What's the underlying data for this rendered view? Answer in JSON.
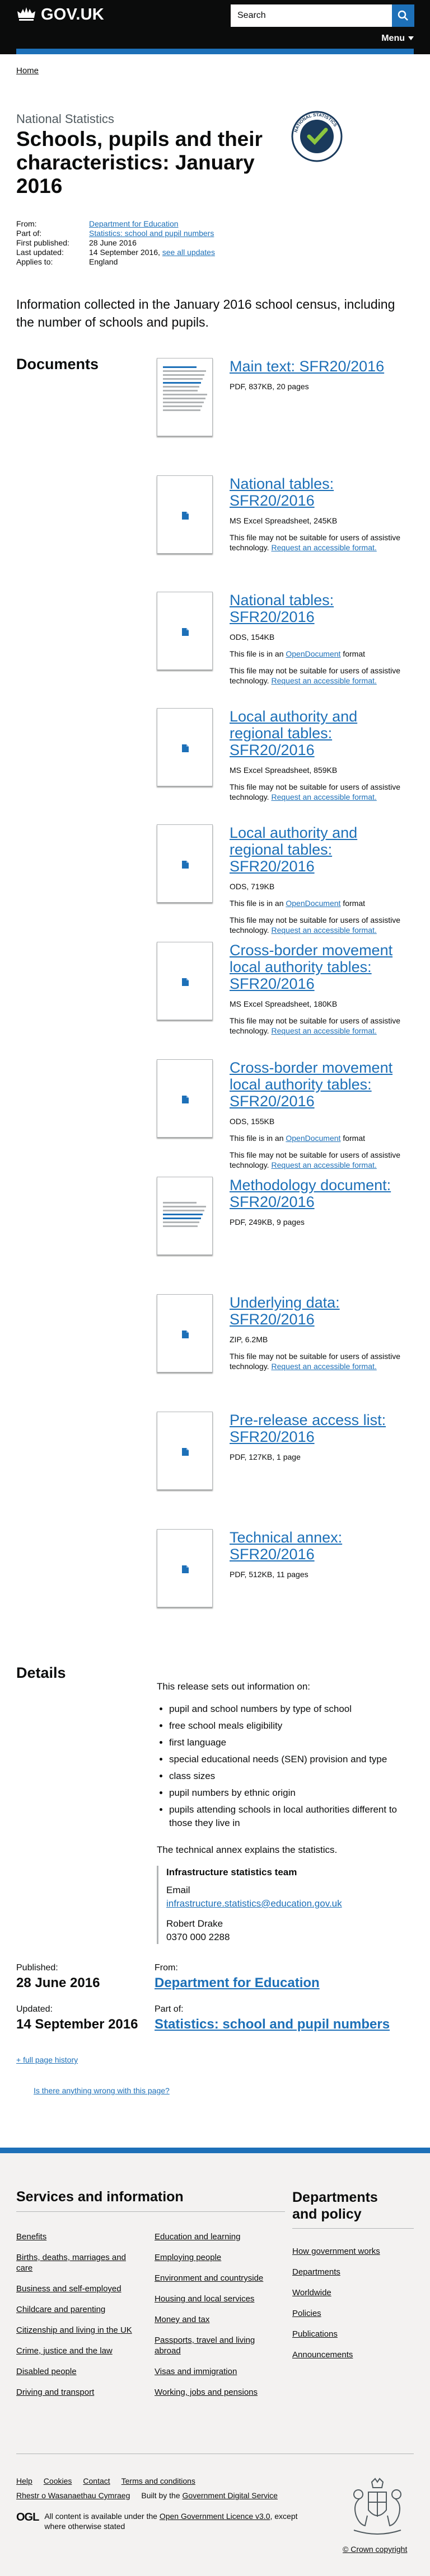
{
  "header": {
    "logo_text": "GOV.UK",
    "search_placeholder": "Search",
    "menu_label": "Menu"
  },
  "breadcrumb": [
    "Home"
  ],
  "page": {
    "document_type": "National Statistics",
    "title": "Schools, pupils and their characteristics: January 2016",
    "org_logo_text": "NATIONAL STATISTICS"
  },
  "metadata": {
    "from_label": "From:",
    "from_value": "Department for Education",
    "part_of_label": "Part of:",
    "part_of_value": "Statistics: school and pupil numbers",
    "first_published_label": "First published:",
    "first_published_value": "28 June 2016",
    "last_updated_label": "Last updated:",
    "last_updated_value": "14 September 2016,",
    "see_all_updates": "see all updates",
    "applies_to_label": "Applies to:",
    "applies_to_value": "England"
  },
  "summary": "Information collected in the January 2016 school census, including the number of schools and pupils.",
  "documents": {
    "heading": "Documents",
    "accessibility_note": "This file may not be suitable for users of assistive technology.",
    "accessibility_link": "Request an accessible format.",
    "opendocument_prefix": "This file is in an",
    "opendocument_link": "OpenDocument",
    "opendocument_suffix": "format",
    "items": [
      {
        "title": "Main text: SFR20/2016",
        "meta": "PDF, 837KB, 20 pages"
      },
      {
        "title": "National tables: SFR20/2016",
        "meta": "MS Excel Spreadsheet, 245KB"
      },
      {
        "title": "National tables: SFR20/2016",
        "meta": "ODS, 154KB"
      },
      {
        "title": "Local authority and regional tables: SFR20/2016",
        "meta": "MS Excel Spreadsheet, 859KB"
      },
      {
        "title": "Local authority and regional tables: SFR20/2016",
        "meta": "ODS, 719KB"
      },
      {
        "title": "Cross-border movement local authority tables: SFR20/2016",
        "meta": "MS Excel Spreadsheet, 180KB"
      },
      {
        "title": "Cross-border movement local authority tables: SFR20/2016",
        "meta": "ODS, 155KB"
      },
      {
        "title": "Methodology document: SFR20/2016",
        "meta": "PDF, 249KB, 9 pages"
      },
      {
        "title": "Underlying data: SFR20/2016",
        "meta": "ZIP, 6.2MB"
      },
      {
        "title": "Pre-release access list: SFR20/2016",
        "meta": "PDF, 127KB, 1 page"
      },
      {
        "title": "Technical annex: SFR20/2016",
        "meta": "PDF, 512KB, 11 pages"
      }
    ]
  },
  "details": {
    "heading": "Details",
    "intro": "This release sets out information on:",
    "bullets": [
      "pupil and school numbers by type of school",
      "free school meals eligibility",
      "first language",
      "special educational needs (SEN) provision and type",
      "class sizes",
      "pupil numbers by ethnic origin",
      "pupils attending schools in local authorities different to those they live in"
    ],
    "technical_note": "The technical annex explains the statistics.",
    "contact": {
      "team": "Infrastructure statistics team",
      "email_label": "Email",
      "email": "infrastructure.statistics@education.gov.uk",
      "person": "Robert Drake",
      "phone": "0370 000 2288"
    }
  },
  "published_meta": {
    "published_label": "Published:",
    "published_value": "28 June 2016",
    "updated_label": "Updated:",
    "updated_value": "14 September 2016",
    "from_label": "From:",
    "from_value": "Department for Education",
    "part_of_label": "Part of:",
    "part_of_value": "Statistics: school and pupil numbers",
    "history_link": "+ full page history",
    "report_link": "Is there anything wrong with this page?"
  },
  "footer": {
    "services_heading": "Services and information",
    "departments_heading": "Departments and policy",
    "services_col1": [
      "Benefits",
      "Births, deaths, marriages and care",
      "Business and self-employed",
      "Childcare and parenting",
      "Citizenship and living in the UK",
      "Crime, justice and the law",
      "Disabled people",
      "Driving and transport"
    ],
    "services_col2": [
      "Education and learning",
      "Employing people",
      "Environment and countryside",
      "Housing and local services",
      "Money and tax",
      "Passports, travel and living abroad",
      "Visas and immigration",
      "Working, jobs and pensions"
    ],
    "departments": [
      "How government works",
      "Departments",
      "Worldwide",
      "Policies",
      "Publications",
      "Announcements"
    ],
    "links": [
      "Help",
      "Cookies",
      "Contact",
      "Terms and conditions"
    ],
    "welsh_link": "Rhestr o Wasanaethau Cymraeg",
    "built_by_prefix": "Built by the",
    "built_by_link": "Government Digital Service",
    "ogl_label": "OGL",
    "ogl_prefix": "All content is available under the",
    "ogl_link": "Open Government Licence v3.0",
    "ogl_suffix": ", except where otherwise stated",
    "copyright": "© Crown copyright"
  },
  "colors": {
    "brand_black": "#0b0c0c",
    "link_blue": "#1d70b8",
    "footer_bg": "#f3f2f1",
    "border_grey": "#b1b4b6"
  }
}
